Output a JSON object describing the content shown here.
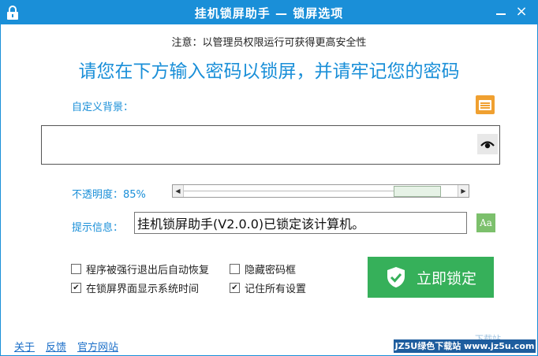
{
  "window": {
    "title": "挂机锁屏助手 — 锁屏选项",
    "close_glyph": "×",
    "accent_color": "#1a8fd8"
  },
  "notice": "注意：以管理员权限运行可获得更高安全性",
  "headline": "请您在下方输入密码以锁屏，并请牢记您的密码",
  "background": {
    "label": "自定义背景：",
    "browse_icon": "folder-icon",
    "visibility_icon": "eye-icon"
  },
  "opacity": {
    "label": "不透明度：85%",
    "value_percent": 85,
    "left_arrow": "◀",
    "right_arrow": "▶"
  },
  "hint": {
    "label": "提示信息：",
    "value": "挂机锁屏助手(V2.0.0)已锁定该计算机。",
    "font_button": "Aa"
  },
  "options": [
    {
      "label": "程序被强行退出后自动恢复",
      "checked": false
    },
    {
      "label": "在锁屏界面显示系统时间",
      "checked": true
    },
    {
      "label": "隐藏密码框",
      "checked": false
    },
    {
      "label": "记住所有设置",
      "checked": true
    }
  ],
  "lock_button": {
    "label": "立即锁定",
    "color": "#36b05a",
    "icon": "shield-check-icon"
  },
  "footer": {
    "about": "关于",
    "feedback": "反馈",
    "website": "官方网站"
  },
  "watermark": {
    "text": "JZ5U绿色下载站 www.jz5u.com",
    "back_text": "…下载站"
  }
}
